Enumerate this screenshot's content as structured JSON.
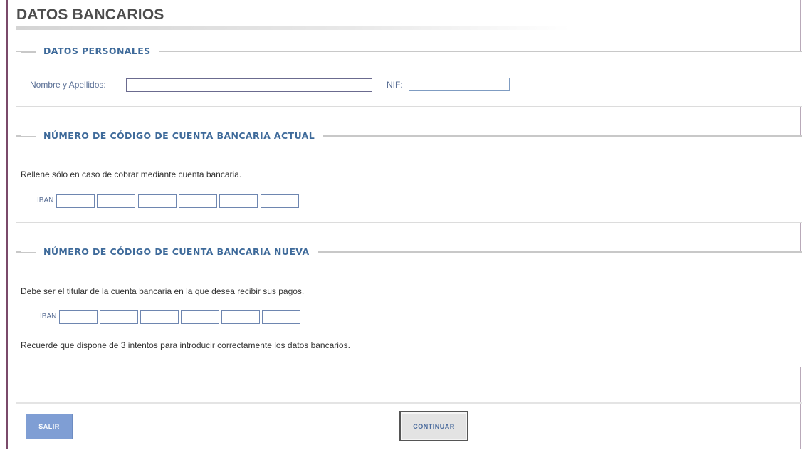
{
  "page": {
    "title": "DATOS BANCARIOS"
  },
  "personal": {
    "legend": "DATOS PERSONALES",
    "name_label": "Nombre y Apellidos:",
    "name_value": "",
    "nif_label": "NIF:",
    "nif_value": ""
  },
  "current_account": {
    "legend": "NÚMERO DE CÓDIGO DE CUENTA BANCARIA ACTUAL",
    "note": "Rellene sólo en caso de cobrar mediante cuenta bancaria.",
    "iban_label": "IBAN",
    "iban_fields": [
      "",
      "",
      "",
      "",
      "",
      ""
    ]
  },
  "new_account": {
    "legend": "NÚMERO DE CÓDIGO DE CUENTA BANCARIA NUEVA",
    "note": "Debe ser el titular de la cuenta bancaria en la que desea recibir sus pagos.",
    "iban_label": "IBAN",
    "iban_fields": [
      "",
      "",
      "",
      "",
      "",
      ""
    ],
    "reminder": "Recuerde que dispone de 3 intentos para introducir correctamente los datos bancarios."
  },
  "footer": {
    "exit_label": "SALIR",
    "continue_label": "CONTINUAR"
  },
  "colors": {
    "legend_text": "#3e6a9a",
    "exit_button": "#7f9ed4",
    "frame_border": "#7a4a6a"
  }
}
